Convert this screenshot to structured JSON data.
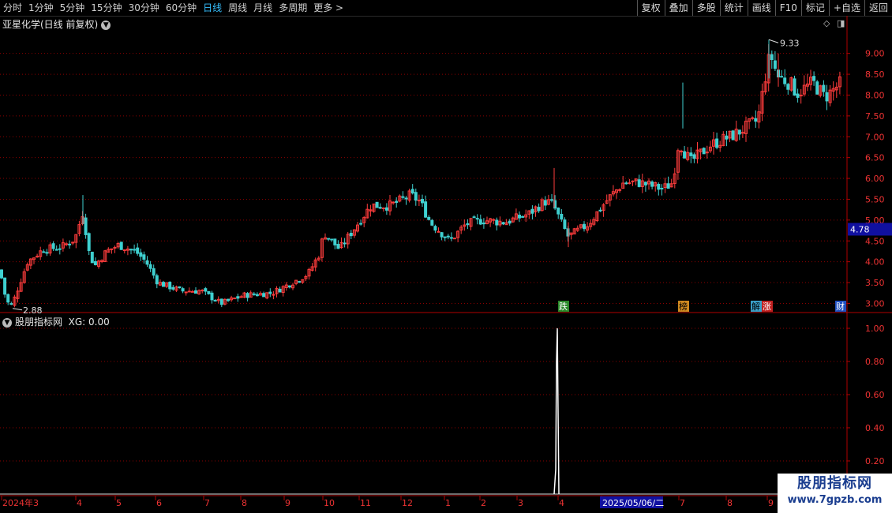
{
  "toolbar": {
    "period_tabs": [
      "分时",
      "1分钟",
      "5分钟",
      "15分钟",
      "30分钟",
      "60分钟",
      "日线",
      "周线",
      "月线",
      "多周期",
      "更多 >"
    ],
    "active_tab": "日线",
    "tools": [
      "复权",
      "叠加",
      "多股",
      "统计",
      "画线",
      "F10",
      "标记",
      "+自选",
      "返回"
    ]
  },
  "main_chart": {
    "title": "亚星化学(日线 前复权)",
    "current_price": "4.78",
    "high_label": "9.33",
    "low_label": "2.88",
    "y_ticks": [
      "9.00",
      "8.50",
      "8.00",
      "7.50",
      "7.00",
      "6.50",
      "6.00",
      "5.50",
      "5.00",
      "4.50",
      "4.00",
      "3.50",
      "3.00"
    ],
    "event_tags": [
      "跌",
      "榜",
      "解",
      "涨",
      "财"
    ]
  },
  "indicator": {
    "title": "股朋指标网",
    "label": "XG: 0.00",
    "y_ticks": [
      "1.00",
      "0.80",
      "0.60",
      "0.40",
      "0.20"
    ]
  },
  "date_axis": [
    "2024年3",
    "4",
    "5",
    "6",
    "7",
    "8",
    "9",
    "10",
    "11",
    "12",
    "1",
    "2",
    "3",
    "4",
    "2025/05/06/二",
    "7",
    "8",
    "9"
  ],
  "watermark": {
    "line1": "股朋指标网",
    "line2": "www.7gpzb.com"
  },
  "colors": {
    "up": "#ff3c3c",
    "down": "#3fd0d0",
    "grid": "#8b0000",
    "accent": "#36c0ff",
    "price_box": "#1010a0"
  },
  "chart_data": {
    "type": "candlestick",
    "price_anchors": [
      [
        0,
        3.8
      ],
      [
        8,
        3.05
      ],
      [
        15,
        2.95
      ],
      [
        35,
        4.0
      ],
      [
        55,
        4.3
      ],
      [
        78,
        4.35
      ],
      [
        95,
        4.55
      ],
      [
        105,
        5.2
      ],
      [
        113,
        4.2
      ],
      [
        120,
        3.9
      ],
      [
        135,
        4.25
      ],
      [
        150,
        4.4
      ],
      [
        172,
        4.25
      ],
      [
        185,
        4.0
      ],
      [
        200,
        3.5
      ],
      [
        230,
        3.3
      ],
      [
        255,
        3.3
      ],
      [
        280,
        3.0
      ],
      [
        310,
        3.2
      ],
      [
        345,
        3.25
      ],
      [
        365,
        3.45
      ],
      [
        390,
        3.7
      ],
      [
        405,
        4.2
      ],
      [
        410,
        4.7
      ],
      [
        430,
        4.3
      ],
      [
        445,
        4.7
      ],
      [
        470,
        5.35
      ],
      [
        495,
        5.35
      ],
      [
        520,
        5.6
      ],
      [
        532,
        5.45
      ],
      [
        545,
        4.95
      ],
      [
        570,
        4.5
      ],
      [
        590,
        4.9
      ],
      [
        610,
        5.0
      ],
      [
        640,
        4.95
      ],
      [
        670,
        5.15
      ],
      [
        690,
        5.45
      ],
      [
        700,
        5.4
      ],
      [
        712,
        4.9
      ],
      [
        720,
        4.6
      ],
      [
        745,
        4.9
      ],
      [
        770,
        5.5
      ],
      [
        790,
        5.9
      ],
      [
        810,
        5.9
      ],
      [
        840,
        5.75
      ],
      [
        852,
        5.9
      ],
      [
        860,
        6.9
      ],
      [
        868,
        6.6
      ],
      [
        875,
        6.4
      ],
      [
        900,
        6.8
      ],
      [
        930,
        7.05
      ],
      [
        960,
        7.4
      ],
      [
        970,
        8.5
      ],
      [
        976,
        9.0
      ],
      [
        985,
        8.45
      ],
      [
        1000,
        8.3
      ],
      [
        1010,
        8.05
      ],
      [
        1030,
        8.3
      ],
      [
        1045,
        7.95
      ],
      [
        1066,
        8.3
      ]
    ],
    "price_range": [
      2.8,
      9.6
    ],
    "xg_signal": {
      "position": "2025-04",
      "value": 1.0
    },
    "xg_range": [
      0,
      1.05
    ]
  }
}
